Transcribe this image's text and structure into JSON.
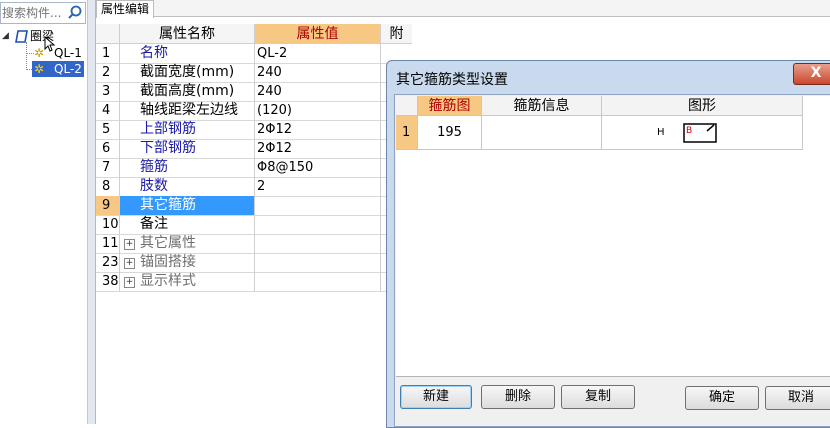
{
  "search": {
    "placeholder": "搜索构件..."
  },
  "tree": {
    "root": {
      "label": "圈梁",
      "icon": "beam-category-icon"
    },
    "children": [
      {
        "label": "QL-1",
        "icon": "gear-icon",
        "selected": false
      },
      {
        "label": "QL-2",
        "icon": "gear-icon",
        "selected": true
      }
    ]
  },
  "tab": {
    "label": "属性编辑"
  },
  "property_grid": {
    "columns": {
      "name": "属性名称",
      "value": "属性值",
      "extra": "附"
    },
    "rows": [
      {
        "num": "1",
        "name": "名称",
        "value": "QL-2",
        "style": "blue"
      },
      {
        "num": "2",
        "name": "截面宽度(mm)",
        "value": "240",
        "style": "normal"
      },
      {
        "num": "3",
        "name": "截面高度(mm)",
        "value": "240",
        "style": "normal"
      },
      {
        "num": "4",
        "name": "轴线距梁左边线",
        "value": "(120)",
        "style": "normal"
      },
      {
        "num": "5",
        "name": "上部钢筋",
        "value": "2Φ12",
        "style": "blue"
      },
      {
        "num": "6",
        "name": "下部钢筋",
        "value": "2Φ12",
        "style": "blue"
      },
      {
        "num": "7",
        "name": "箍筋",
        "value": "Φ8@150",
        "style": "blue"
      },
      {
        "num": "8",
        "name": "肢数",
        "value": "2",
        "style": "blue"
      },
      {
        "num": "9",
        "name": "其它箍筋",
        "value": "",
        "style": "selected"
      },
      {
        "num": "10",
        "name": "备注",
        "value": "",
        "style": "normal"
      },
      {
        "num": "11",
        "name": "其它属性",
        "value": "",
        "style": "group"
      },
      {
        "num": "23",
        "name": "锚固搭接",
        "value": "",
        "style": "group"
      },
      {
        "num": "38",
        "name": "显示样式",
        "value": "",
        "style": "group"
      }
    ]
  },
  "dialog": {
    "title": "其它箍筋类型设置",
    "close_label": "X",
    "table": {
      "columns": {
        "diagram": "箍筋图",
        "info": "箍筋信息",
        "shape": "图形"
      },
      "rows": [
        {
          "num": "1",
          "diagram": "195",
          "info": "",
          "shape_label_h": "H",
          "shape_label_b": "B"
        }
      ]
    },
    "buttons": {
      "new": "新建",
      "delete": "删除",
      "copy": "复制",
      "ok": "确定",
      "cancel": "取消"
    }
  },
  "colors": {
    "selection": "#3399ff",
    "accent_header": "#f6c884",
    "dialog_frame": "#c9d9ee"
  }
}
